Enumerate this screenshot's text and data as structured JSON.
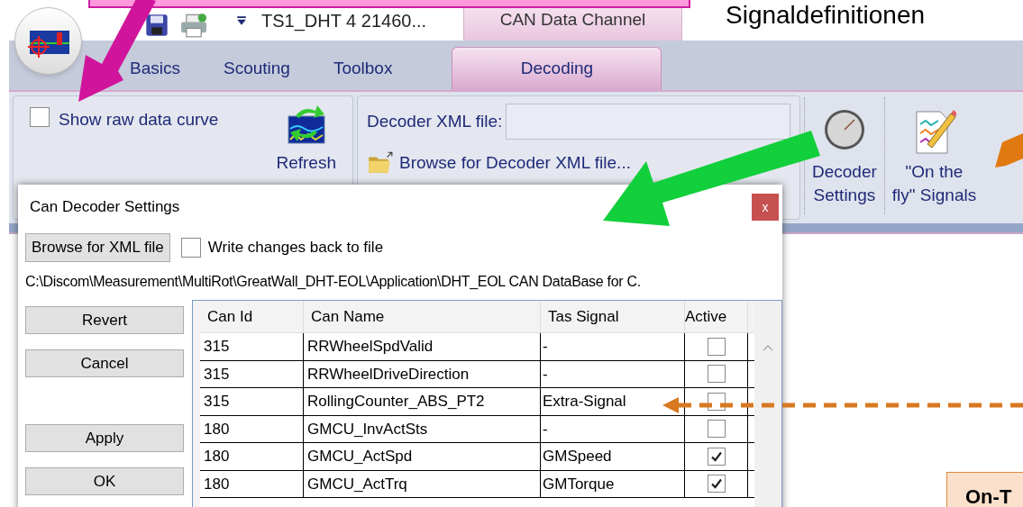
{
  "slide": {
    "heading": "Signaldefinitionen",
    "callout": "On-T"
  },
  "app": {
    "title": "TS1_DHT 4 21460...",
    "context_tab_group": "CAN Data Channel",
    "tabs": [
      {
        "label": "Basics",
        "selected": false
      },
      {
        "label": "Scouting",
        "selected": false
      },
      {
        "label": "Toolbox",
        "selected": false
      },
      {
        "label": "Decoding",
        "selected": true
      }
    ],
    "ribbon": {
      "show_raw_data_curve": {
        "label": "Show raw data curve",
        "checked": false
      },
      "refresh_label": "Refresh",
      "decoder_xml_label": "Decoder XML file:",
      "browse_label": "Browse for Decoder XML file...",
      "buttons": [
        {
          "label": "Decoder\nSettings",
          "kind": "knob"
        },
        {
          "label": "\"On the\nfly\" Signals",
          "kind": "chart-pencil"
        }
      ]
    }
  },
  "dialog": {
    "title": "Can Decoder Settings",
    "close": "x",
    "browse_button": "Browse for XML file",
    "write_back": {
      "label": "Write changes back to file",
      "checked": false
    },
    "path": "C:\\Discom\\Measurement\\MultiRot\\GreatWall_DHT-EOL\\Application\\DHT_EOL CAN DataBase for C.",
    "side_buttons": [
      "Revert",
      "Cancel",
      "Apply",
      "OK"
    ],
    "table": {
      "columns": [
        "Can Id",
        "Can Name",
        "Tas Signal",
        "Active"
      ],
      "rows": [
        {
          "can_id": "315",
          "can_name": "RRWheelSpdValid",
          "tas_signal": "-",
          "active": false
        },
        {
          "can_id": "315",
          "can_name": "RRWheelDriveDirection",
          "tas_signal": "-",
          "active": false
        },
        {
          "can_id": "315",
          "can_name": "RollingCounter_ABS_PT2",
          "tas_signal": "Extra-Signal",
          "active": false
        },
        {
          "can_id": "180",
          "can_name": "GMCU_InvActSts",
          "tas_signal": "-",
          "active": false
        },
        {
          "can_id": "180",
          "can_name": "GMCU_ActSpd",
          "tas_signal": "GMSpeed",
          "active": true
        },
        {
          "can_id": "180",
          "can_name": "GMCU_ActTrq",
          "tas_signal": "GMTorque",
          "active": true
        }
      ]
    }
  }
}
